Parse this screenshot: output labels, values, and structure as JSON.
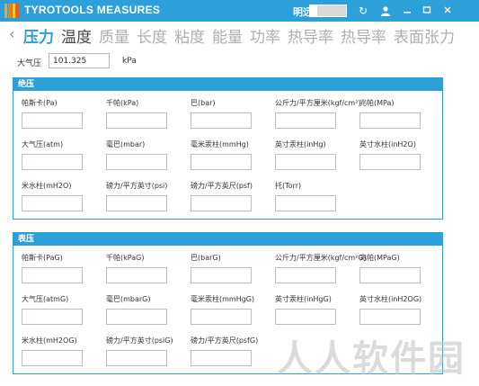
{
  "window": {
    "title": "TYROTOOLS MEASURES",
    "mode_label": "明远",
    "icons": [
      "refresh-icon",
      "user-icon",
      "minimize-icon",
      "restore-icon",
      "close-icon"
    ]
  },
  "tabs": {
    "left_arrow": "‹",
    "items": [
      "压力",
      "温度",
      "质量",
      "长度",
      "粘度",
      "能量",
      "功率",
      "热导率",
      "热导率",
      "表面张力"
    ],
    "active_index": 0
  },
  "atmosphere": {
    "label": "大气压",
    "value": "101.325",
    "unit": "kPa"
  },
  "absolute": {
    "title": "绝压",
    "fields": [
      "帕斯卡(Pa)",
      "千帕(kPa)",
      "巴(bar)",
      "公斤力/平方厘米(kgf/cm²)",
      "兆帕(MPa)",
      "大气压(atm)",
      "毫巴(mbar)",
      "毫米汞柱(mmHg)",
      "英寸汞柱(inHg)",
      "英寸水柱(inH2O)",
      "米水柱(mH2O)",
      "磅力/平方英寸(psi)",
      "磅力/平方英尺(psf)",
      "托(Torr)"
    ]
  },
  "gauge": {
    "title": "表压",
    "fields": [
      "帕斯卡(PaG)",
      "千帕(kPaG)",
      "巴(barG)",
      "公斤力/平方厘米(kgf/cm²G)",
      "兆帕(MPaG)",
      "大气压(atmG)",
      "毫巴(mbarG)",
      "毫米汞柱(mmHgG)",
      "英寸汞柱(inHgG)",
      "英寸水柱(inH2OG)",
      "米水柱(mH2OG)",
      "磅力/平方英寸(psiG)",
      "磅力/平方英尺(psfG)"
    ]
  },
  "watermark": "人人软件园",
  "colors": {
    "accent": "#2d9fd9",
    "logo": "#f6a21b",
    "tab_inactive": "#aeaeae"
  }
}
